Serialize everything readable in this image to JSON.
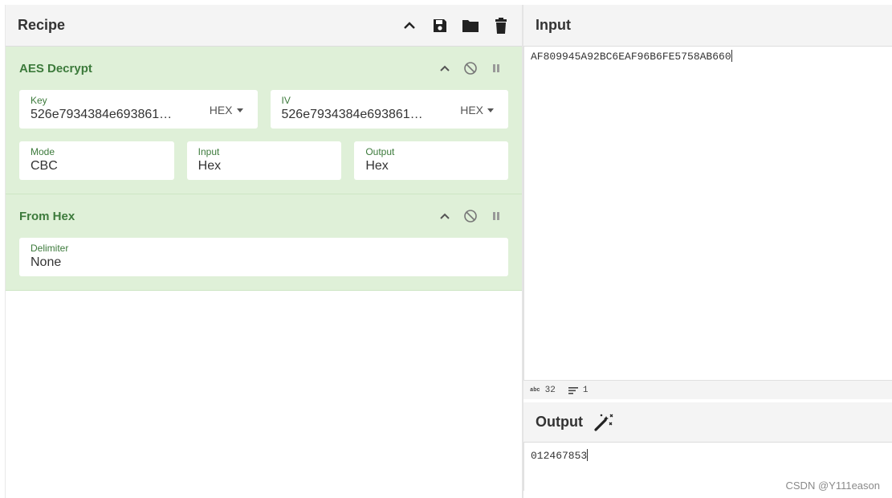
{
  "recipe": {
    "title": "Recipe",
    "header_icons": [
      "chevron-up-icon",
      "save-icon",
      "folder-icon",
      "trash-icon"
    ],
    "operations": [
      {
        "title": "AES Decrypt",
        "key": {
          "label": "Key",
          "value": "526e7934384e693861…",
          "format": "HEX"
        },
        "iv": {
          "label": "IV",
          "value": "526e7934384e693861…",
          "format": "HEX"
        },
        "mode": {
          "label": "Mode",
          "value": "CBC"
        },
        "input": {
          "label": "Input",
          "value": "Hex"
        },
        "output": {
          "label": "Output",
          "value": "Hex"
        }
      },
      {
        "title": "From Hex",
        "delimiter": {
          "label": "Delimiter",
          "value": "None"
        }
      }
    ],
    "op_icons": [
      "chevron-up-icon",
      "disable-icon",
      "pause-icon"
    ]
  },
  "input": {
    "title": "Input",
    "value": "AF809945A92BC6EAF96B6FE5758AB660",
    "stats": {
      "length_label": "abc",
      "length": "32",
      "lines": "1"
    }
  },
  "output": {
    "title": "Output",
    "value": "012467853",
    "magic_icon": "magic-wand-icon"
  },
  "watermark": "CSDN @Y111eason",
  "colors": {
    "op_bg": "#dff0d8",
    "op_title": "#3c7a3b",
    "header_bg": "#f4f4f4"
  }
}
